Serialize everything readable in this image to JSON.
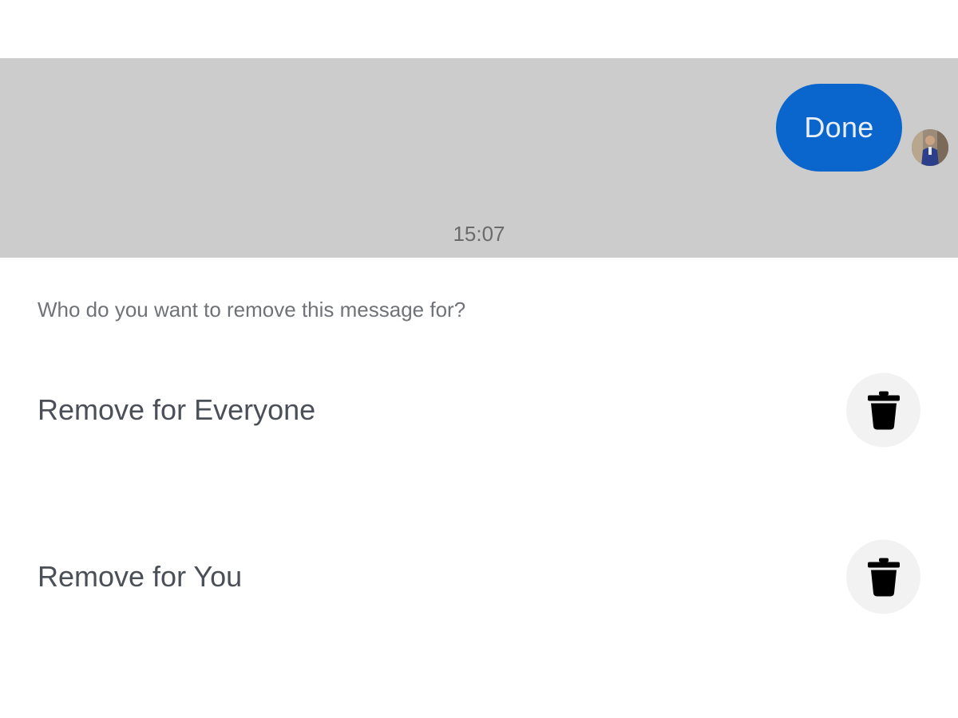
{
  "message": {
    "bubble_text": "Done",
    "timestamp": "15:07",
    "bubble_color": "#0a66cc",
    "background_color": "#cccccc"
  },
  "avatar": {
    "icon": "user-avatar"
  },
  "sheet": {
    "prompt": "Who do you want to remove this message for?",
    "options": [
      {
        "label": "Remove for Everyone",
        "icon": "trash-icon"
      },
      {
        "label": "Remove for You",
        "icon": "trash-icon"
      }
    ]
  }
}
